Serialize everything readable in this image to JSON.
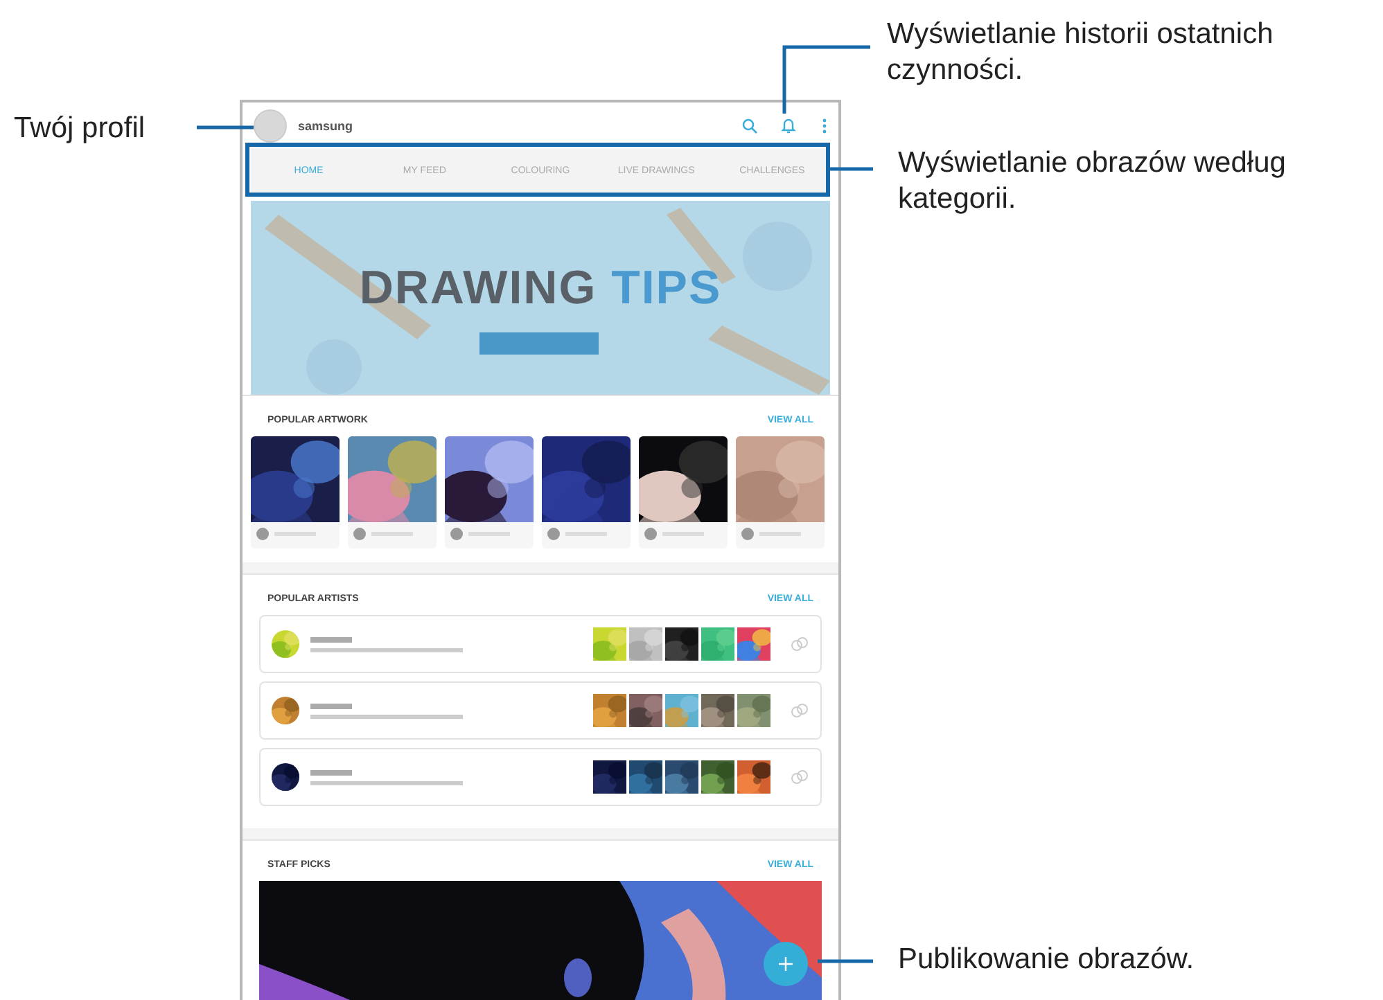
{
  "profile": {
    "name": "samsung"
  },
  "tabs": [
    {
      "label": "HOME",
      "selected": true
    },
    {
      "label": "MY FEED",
      "selected": false
    },
    {
      "label": "COLOURING",
      "selected": false
    },
    {
      "label": "LIVE DRAWINGS",
      "selected": false
    },
    {
      "label": "CHALLENGES",
      "selected": false
    }
  ],
  "banner": {
    "title": "DRAWING",
    "title_accent": "TIPS"
  },
  "sections": [
    {
      "title": "POPULAR ARTWORK",
      "link": "VIEW ALL",
      "kind": "artwork"
    },
    {
      "title": "POPULAR ARTISTS",
      "link": "VIEW ALL",
      "kind": "artists"
    },
    {
      "title": "STAFF PICKS",
      "link": "VIEW ALL",
      "kind": "staff"
    }
  ],
  "callouts": [
    {
      "kind": "profile",
      "text": "Twój profil"
    },
    {
      "kind": "history",
      "text": "Wyświetlanie historii ostatnich czynności."
    },
    {
      "kind": "categories",
      "text": "Wyświetlanie obrazów według kategorii."
    },
    {
      "kind": "publish",
      "text": "Publikowanie obrazów."
    }
  ]
}
